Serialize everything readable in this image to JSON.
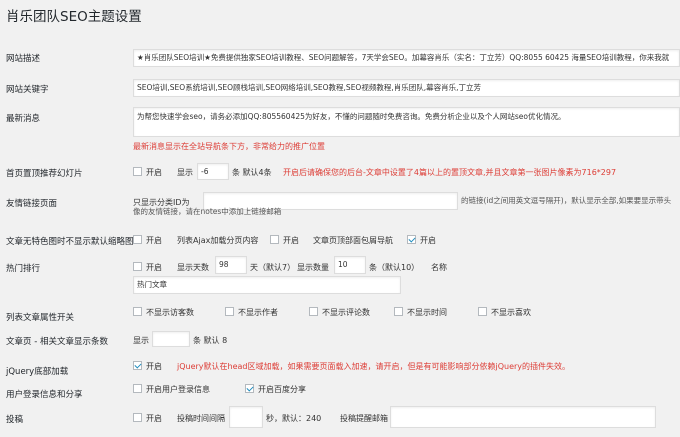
{
  "page_title": "肖乐团队SEO主题设置",
  "site_desc": {
    "label": "网站描述",
    "value": "★肖乐团队SEO培训★免费提供独家SEO培训教程、SEO问题解答，7天学会SEO。加幕容肖乐（实名：丁立芳）QQ:8055 60425 海量SEO培训教程，你来我就"
  },
  "site_keywords": {
    "label": "网站关键字",
    "value": "SEO培训,SEO系统培训,SEO顾栈培训,SEO网络培训,SEO教程,SEO视频教程,肖乐团队,幕容肖乐,丁立芳"
  },
  "latest_news": {
    "label": "最新消息",
    "value": "为帮您快速学会seo，请务必添加QQ:805560425为好友，不懂的问题随时免费咨询。免费分析企业以及个人网站seo优化情况。",
    "hint": "最新消息显示在全站导航条下方，非常给力的推广位置"
  },
  "homepage_slider": {
    "label": "首页置顶推荐幻灯片",
    "enable": "开启",
    "show": "显示",
    "count": "-6",
    "count_unit": "条 默认4条",
    "note": "开启后请确保您的后台-文章中设置了4篇以上的置顶文章,并且文章第一张图片像素为716*297"
  },
  "friend_links": {
    "label": "友情链接页面",
    "prefix": "只显示分类ID为",
    "value": "",
    "desc": "的链接(id之间用英文逗号隔开)，默认显示全部,如果要显示带头像的友情链接，请在notes中添加上链接邮箱"
  },
  "no_thumb": {
    "label": "文章无特色图时不显示默认缩略图",
    "enable": "开启",
    "ajax_label": "列表Ajax加载分页内容",
    "ajax_enable": "开启",
    "crumb_label": "文章页顶部面包屑导航",
    "crumb_enable": "开启"
  },
  "hot_ranking": {
    "label": "热门排行",
    "enable": "开启",
    "days_label": "显示天数",
    "days_value": "98",
    "days_unit": "天（默认7）",
    "num_label": "显示数量",
    "num_value": "10",
    "num_unit": "条（默认10）",
    "name_label": "名称",
    "name_value": "热门文章"
  },
  "list_attrs": {
    "label": "列表文章属性开关",
    "items": [
      "不显示访客数",
      "不显示作者",
      "不显示评论数",
      "不显示时间",
      "不显示喜欢"
    ]
  },
  "related_posts": {
    "label": "文章页 - 相关文章显示条数",
    "show": "显示",
    "value": "",
    "unit": "条 默认 8"
  },
  "jquery_footer": {
    "label": "jQuery底部加载",
    "enable": "开启",
    "note": "jQuery默认在head区域加载，如果需要页面载入加速，请开启，但是有可能影响部分依赖jQuery的插件失效。"
  },
  "user_login": {
    "label": "用户登录信息和分享",
    "login_enable": "开启用户登录信息",
    "share_enable": "开启百度分享"
  },
  "submission": {
    "label": "投稿",
    "enable": "开启",
    "interval_label": "投稿时间间隔",
    "interval_value": "",
    "interval_unit": "秒，默认：240",
    "email_label": "投稿提醒邮箱",
    "email_value": ""
  }
}
